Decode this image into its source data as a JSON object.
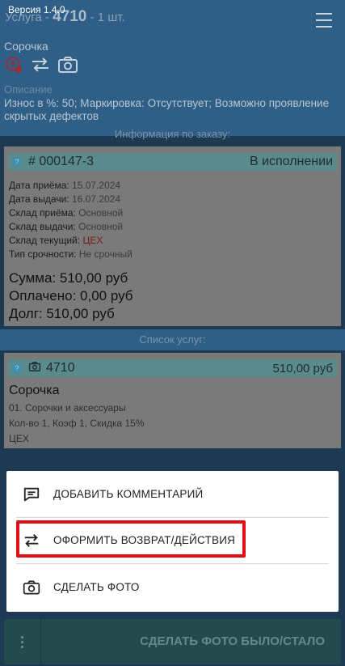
{
  "header": {
    "version": "Версия 1.4.0",
    "service_prefix": "Услуга - ",
    "service_number": "4710",
    "service_qty": " - 1 шт.",
    "item_name": "Сорочка",
    "description_label": "Описание",
    "description_text": "Износ в %: 50; Маркировка: Отсутствует; Возможно проявление скрытых дефектов",
    "icons": [
      "alert-tag-icon",
      "swap-icon",
      "camera-icon"
    ]
  },
  "info_heading": "Информация по заказу:",
  "order": {
    "number": "# 000147-3",
    "status": "В исполнении",
    "fields": [
      {
        "label": "Дата приёма: ",
        "value": "15.07.2024",
        "red": false
      },
      {
        "label": "Дата выдачи: ",
        "value": "16.07.2024",
        "red": false
      },
      {
        "label": "Склад приёма: ",
        "value": "Основной",
        "red": false
      },
      {
        "label": "Склад выдачи: ",
        "value": "Основной",
        "red": false
      },
      {
        "label": "Склад текущий: ",
        "value": "ЦЕХ",
        "red": true
      },
      {
        "label": "Тип срочности: ",
        "value": "Не срочный",
        "red": false
      }
    ],
    "sum": "Сумма: 510,00 руб",
    "paid": "Оплачено: 0,00 руб",
    "debt": "Долг: 510,00 руб"
  },
  "services_heading": "Список услуг:",
  "service": {
    "code": "4710",
    "price": "510,00 руб",
    "name": "Сорочка",
    "category": "01. Сорочки и аксессуары",
    "params": "Кол-во 1, Коэф 1, Скидка 15%",
    "location": "ЦЕХ"
  },
  "sheet": {
    "add_comment": "ДОБАВИТЬ КОММЕНТАРИЙ",
    "return_actions": "ОФОРМИТЬ ВОЗВРАТ/ДЕЙСТВИЯ",
    "take_photo": "СДЕЛАТЬ ФОТО"
  },
  "bottom_bar": {
    "main_label": "СДЕЛАТЬ ФОТО БЫЛО/СТАЛО"
  },
  "colors": {
    "header_bg": "#2f5e86",
    "card_badge": "#5b8a8c",
    "red_text": "#7a1717",
    "highlight_border": "#e10d17",
    "bottom_bar": "#234a4d"
  }
}
